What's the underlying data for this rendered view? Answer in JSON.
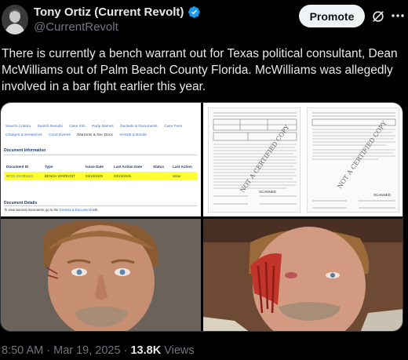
{
  "author": {
    "name": "Tony Ortiz (Current Revolt)",
    "handle": "@CurrentRevolt"
  },
  "actions": {
    "promote_label": "Promote"
  },
  "tweet": {
    "text": "There is currently a bench warrant out for Texas political consultant, Dean McWilliams out of Palm Beach County Florida. McWilliams was allegedly involved in a bar fight earlier this year."
  },
  "media": {
    "court_record": {
      "nav_links": [
        "Search Criteria",
        "Search Results",
        "Case Info",
        "Party Names",
        "Dockets & Documents",
        "Case Fees",
        "Charges & Sentences",
        "Court Events",
        "Warrants & Sec Docs",
        "Arrests & Bonds"
      ],
      "active_link": "Warrants & Sec Docs",
      "section_title": "Document Information",
      "columns": [
        "Document ID",
        "Type",
        "Issue Date",
        "Last Action Date",
        "Status",
        "Last Action"
      ],
      "row": [
        "W721-25-003444",
        "BENCH WARRANT",
        "03/13/2025",
        "03/13/2025",
        "",
        "Issue"
      ],
      "details_title": "Document Details",
      "details_text": "To view warrant documents, go to the",
      "details_link": "Dockets & Documents",
      "details_suffix": "tab."
    },
    "scanned_docs": {
      "watermark": "NOT A CERTIFIED COPY",
      "stamp": "SCANNED"
    }
  },
  "meta": {
    "time": "8:50 AM",
    "sep1": "·",
    "date": "Mar 19, 2025",
    "sep2": "·",
    "views_count": "13.8K",
    "views_label": "Views"
  },
  "colors": {
    "background": "#000000",
    "text": "#e7e9ea",
    "muted": "#71767b",
    "verified": "#1d9bf0",
    "highlight_row": "#ffff33"
  }
}
